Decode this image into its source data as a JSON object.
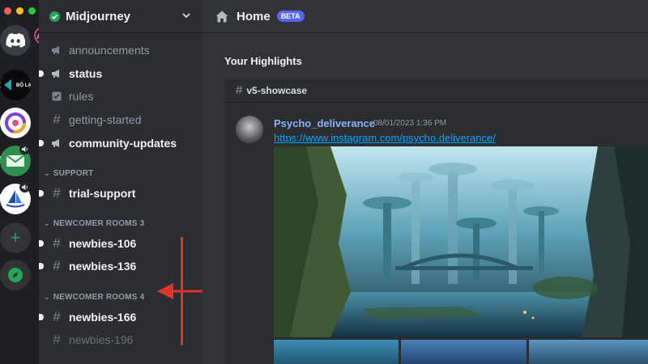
{
  "rail": {
    "servers": [
      {
        "name": "discord-home",
        "icon": "discord-icon"
      },
      {
        "name": "bo-lac",
        "label": "BỘ LẠC"
      },
      {
        "name": "server-ring"
      },
      {
        "name": "server-green"
      },
      {
        "name": "server-boat"
      }
    ],
    "add_label": "+"
  },
  "sidebar": {
    "server_name": "Midjourney",
    "channels_top": [
      {
        "name": "announcements",
        "state": "read",
        "icon": "megaphone-icon"
      },
      {
        "name": "status",
        "state": "unread",
        "icon": "megaphone-icon"
      },
      {
        "name": "rules",
        "state": "read",
        "icon": "checkbox-icon"
      },
      {
        "name": "getting-started",
        "state": "read",
        "icon": "hash-icon"
      },
      {
        "name": "community-updates",
        "state": "unread",
        "icon": "megaphone-icon"
      }
    ],
    "support": {
      "label": "SUPPORT",
      "channels": [
        {
          "name": "trial-support",
          "state": "unread"
        }
      ]
    },
    "newcomer3": {
      "label": "NEWCOMER ROOMS 3",
      "channels": [
        {
          "name": "newbies-106",
          "state": "unread"
        },
        {
          "name": "newbies-136",
          "state": "unread"
        }
      ]
    },
    "newcomer4": {
      "label": "NEWCOMER ROOMS 4",
      "channels": [
        {
          "name": "newbies-166",
          "state": "unread"
        },
        {
          "name": "newbies-196",
          "state": "read"
        }
      ]
    }
  },
  "main": {
    "title": "Home",
    "badge": "BETA",
    "highlights_title": "Your Highlights",
    "card": {
      "channel": "v5-showcase",
      "author": "Psycho_deliverance",
      "timestamp": "08/01/2023 1:36 PM",
      "link": "https://www.instagram.com/psycho.deliverance/"
    }
  },
  "colors": {
    "accent": "#5865f2",
    "online": "#23a55a",
    "annotation": "#e0332b"
  }
}
